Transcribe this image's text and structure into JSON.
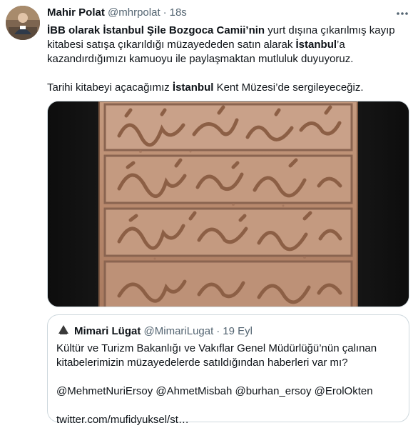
{
  "tweet": {
    "author": {
      "display_name": "Mahir Polat",
      "handle": "@mhrpolat",
      "separator": "·",
      "time": "18s"
    },
    "text": {
      "line1_bold": "İBB olarak İstanbul Şile Bozgoca Camii’nin",
      "line1_rest": " yurt dışına çıkarılmış kayıp kitabesi satışa çıkarıldığı müzayededen satın alarak ",
      "line1_bold2": "İstanbul",
      "line1_end": "’a kazandırdığımızı kamuoyu ile paylaşmaktan mutluluk duyuyoruz.",
      "line2_start": "Tarihi kitabeyi açacağımız ",
      "line2_bold": "İstanbul",
      "line2_end": " Kent Müzesi’de sergileyeceğiz."
    },
    "icons": {
      "more": "more-horizontal-icon",
      "avatar": "user-avatar",
      "media": "ottoman-inscription-photo"
    }
  },
  "quoted_tweet": {
    "author": {
      "display_name": "Mimari Lügat",
      "handle": "@MimariLugat",
      "separator": "·",
      "date": "19 Eyl"
    },
    "text": "Kültür ve Turizm Bakanlığı ve Vakıflar Genel Müdürlüğü’nün çalınan kitabelerimizin müzayedelerde satıldığından haberleri var mı?",
    "mentions": "@MehmetNuriErsoy @AhmetMisbah @burhan_ersoy @ErolOkten",
    "link": "twitter.com/mufidyuksel/st…"
  },
  "colors": {
    "text": "#0f1419",
    "secondary": "#536471",
    "border": "#cfd9de",
    "stone": "#b98d72"
  }
}
